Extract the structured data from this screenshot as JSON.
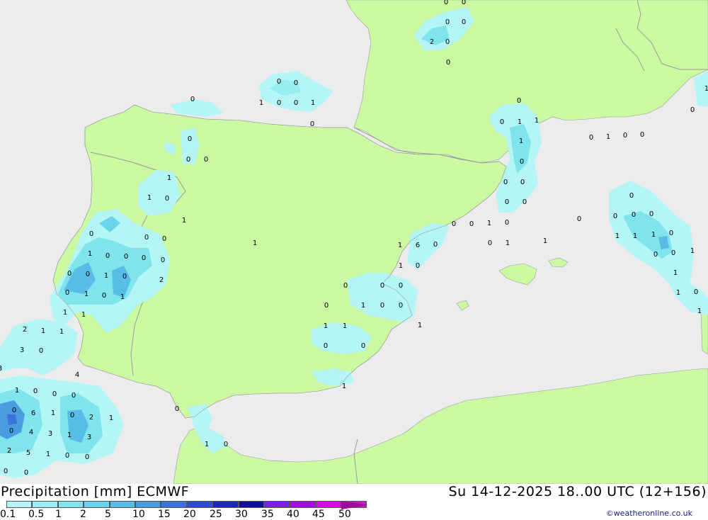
{
  "header": {
    "title_left": "Precipitation [mm] ECMWF",
    "title_right": "Su 14-12-2025 18..00 UTC (12+156)"
  },
  "credit": "©weatheronline.co.uk",
  "colors": {
    "sea": "#ececec",
    "land": "#ccfaa3",
    "border": "#9a9a9a"
  },
  "legend": {
    "labels": [
      "0.1",
      "0.5",
      "1",
      "2",
      "5",
      "10",
      "15",
      "20",
      "25",
      "30",
      "35",
      "40",
      "45",
      "50"
    ],
    "colors": [
      "#b4f6f6",
      "#97eef2",
      "#7fe4ec",
      "#69d4ea",
      "#57bde6",
      "#4a9ce0",
      "#3b72dd",
      "#2d4bd4",
      "#1c25b8",
      "#100f9c",
      "#7a1ee6",
      "#a10ee0",
      "#d40be6",
      "#c41cc0"
    ],
    "arrow_color": "#9c0d9c"
  },
  "map_values": [
    "0",
    "0",
    "0",
    "0",
    "2",
    "0",
    "0",
    "0",
    "0",
    "1",
    "0",
    "0",
    "1",
    "0",
    "0",
    "0",
    "0",
    "0",
    "1",
    "1",
    "0",
    "1",
    "0",
    "0",
    "0",
    "1",
    "0",
    "0",
    "0",
    "0",
    "0",
    "1",
    "0",
    "0",
    "0",
    "1",
    "0",
    "1",
    "2",
    "1",
    "1",
    "2",
    "1",
    "1",
    "3",
    "0",
    "3",
    "4",
    "1",
    "1",
    "6",
    "0",
    "1",
    "0",
    "0",
    "0",
    "0",
    "0",
    "1",
    "0",
    "0",
    "1",
    "1",
    "1",
    "0",
    "0",
    "1",
    "0",
    "0",
    "1",
    "0",
    "0",
    "1",
    "1",
    "0",
    "0",
    "0",
    "1",
    "1",
    "1",
    "0",
    "0",
    "0",
    "0",
    "0",
    "0",
    "1",
    "0",
    "0",
    "1",
    "0",
    "0",
    "0",
    "0",
    "0",
    "1",
    "1",
    "1",
    "0",
    "0",
    "0",
    "1",
    "1",
    "1",
    "0",
    "1",
    "1",
    "0",
    "0",
    "0",
    "0",
    "6",
    "1",
    "0",
    "2",
    "1",
    "0",
    "4",
    "3",
    "1",
    "3",
    "2",
    "5",
    "1",
    "0",
    "0",
    "0",
    "0",
    "1",
    "0",
    "0",
    "0",
    "0",
    "0",
    "1",
    "1",
    "1",
    "0",
    "1",
    "1",
    "1",
    "0",
    "0",
    "0",
    "0"
  ]
}
